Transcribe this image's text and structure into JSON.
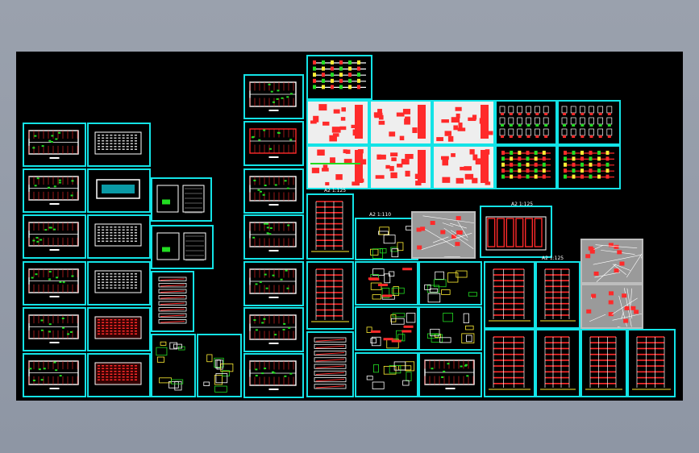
{
  "window": {
    "title": ""
  },
  "colors": {
    "backdrop": "#9aa1ad",
    "canvas": "#000000",
    "sheet_border": "#13e3e6",
    "drawing_red": "#ff2a2a",
    "drawing_white": "#ffffff",
    "drawing_green": "#22dd22",
    "drawing_yellow": "#ffee33"
  },
  "labels": {
    "scale_a": "A2 1:125",
    "scale_b": "A2 1:110",
    "scale_c": "A2 1:125",
    "scale_d": "A2 1:125"
  }
}
